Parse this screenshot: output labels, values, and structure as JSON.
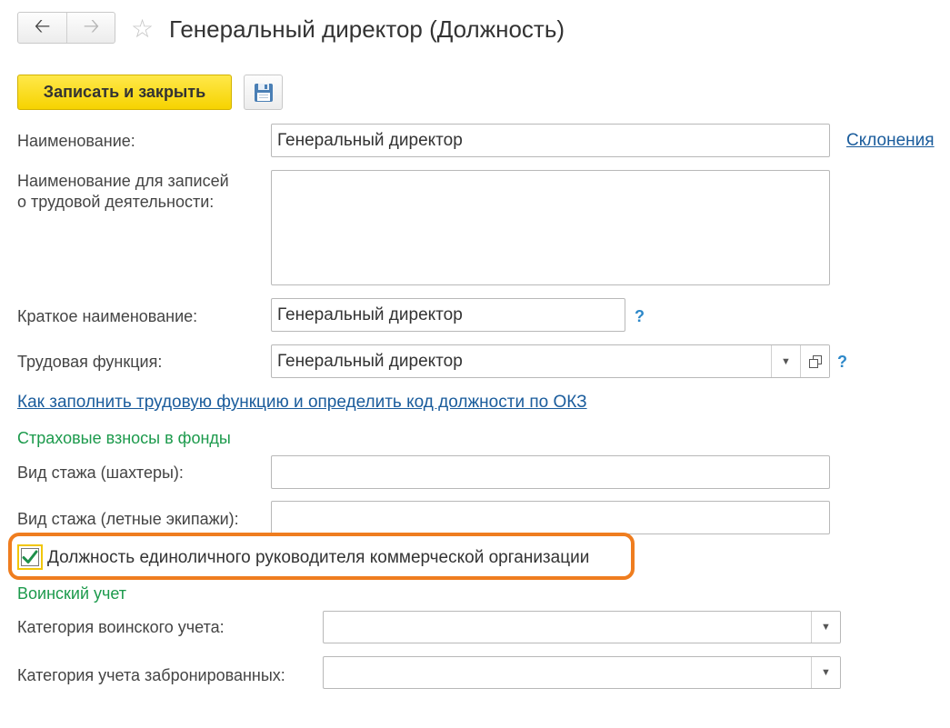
{
  "header": {
    "back_icon": "arrow-left-icon",
    "forward_icon": "arrow-right-icon",
    "favorite_icon": "star-icon",
    "title": "Генеральный директор (Должность)"
  },
  "toolbar": {
    "save_close_label": "Записать и закрыть",
    "save_icon": "floppy-disk-icon"
  },
  "form": {
    "name_label": "Наименование:",
    "name_value": "Генеральный директор",
    "declensions_link": "Склонения",
    "labor_name_label_line1": "Наименование для записей",
    "labor_name_label_line2": "о трудовой деятельности:",
    "labor_name_value": "",
    "short_name_label": "Краткое наименование:",
    "short_name_value": "Генеральный директор",
    "help_mark": "?",
    "labor_function_label": "Трудовая функция:",
    "labor_function_value": "Генеральный директор",
    "okz_link": "Как заполнить трудовую функцию и определить код должности по ОКЗ"
  },
  "insurance": {
    "section_title": "Страховые взносы в фонды",
    "miners_label": "Вид стажа (шахтеры):",
    "miners_value": "",
    "aircrew_label": "Вид стажа (летные экипажи):",
    "aircrew_value": ""
  },
  "sole_head": {
    "label": "Должность единоличного руководителя коммерческой организации",
    "checked": true,
    "highlight_color": "#ef7d1f"
  },
  "military": {
    "section_title": "Воинский учет",
    "category_label": "Категория воинского учета:",
    "category_value": "",
    "reserved_label": "Категория учета забронированных:",
    "reserved_value": ""
  },
  "colors": {
    "primary_button": "#f6d300",
    "link": "#1a5c9c",
    "section_title": "#1c9a4c",
    "help": "#2d88c9"
  }
}
